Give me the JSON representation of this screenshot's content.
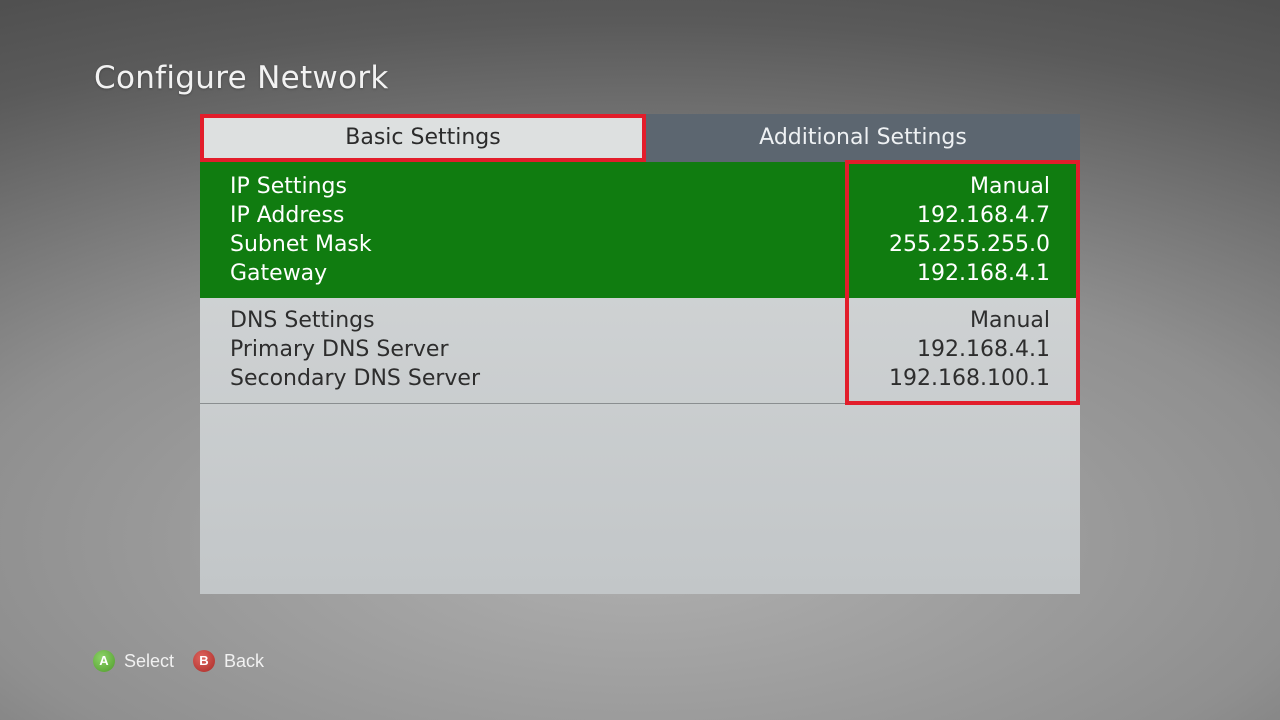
{
  "page": {
    "title": "Configure Network"
  },
  "tabs": [
    {
      "label": "Basic Settings",
      "selected": true
    },
    {
      "label": "Additional Settings",
      "selected": false
    }
  ],
  "ip_settings": [
    {
      "label": "IP Settings",
      "value": "Manual"
    },
    {
      "label": "IP Address",
      "value": "192.168.4.7"
    },
    {
      "label": "Subnet Mask",
      "value": "255.255.255.0"
    },
    {
      "label": "Gateway",
      "value": "192.168.4.1"
    }
  ],
  "dns_settings": [
    {
      "label": "DNS Settings",
      "value": "Manual"
    },
    {
      "label": "Primary DNS Server",
      "value": "192.168.4.1"
    },
    {
      "label": "Secondary DNS Server",
      "value": "192.168.100.1"
    }
  ],
  "footer": {
    "hints": [
      {
        "button": "A",
        "label": "Select",
        "icon": "a-button-icon",
        "color": "#5fae3a"
      },
      {
        "button": "B",
        "label": "Back",
        "icon": "b-button-icon",
        "color": "#c1302b"
      }
    ]
  },
  "colors": {
    "selection_green": "#107c10",
    "highlight_red": "#e21d2b",
    "inactive_tab": "#5c6670"
  }
}
